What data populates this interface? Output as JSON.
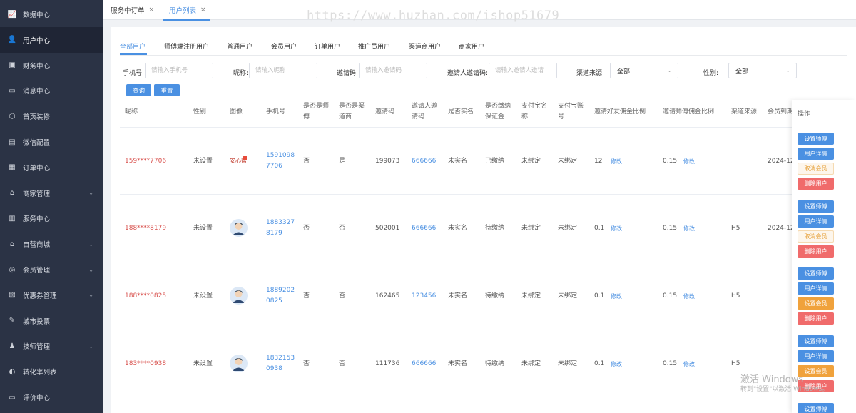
{
  "sidebar": {
    "items": [
      {
        "label": "数据中心",
        "icon": "chart-icon",
        "glyph": "📈",
        "chevron": false
      },
      {
        "label": "用户中心",
        "icon": "user-icon",
        "glyph": "👤",
        "chevron": false,
        "active": true
      },
      {
        "label": "财务中心",
        "icon": "wallet-icon",
        "glyph": "▣",
        "chevron": false
      },
      {
        "label": "消息中心",
        "icon": "message-icon",
        "glyph": "▭",
        "chevron": false
      },
      {
        "label": "首页装修",
        "icon": "box-icon",
        "glyph": "⬡",
        "chevron": false
      },
      {
        "label": "微信配置",
        "icon": "document-gear-icon",
        "glyph": "▤",
        "chevron": false
      },
      {
        "label": "订单中心",
        "icon": "order-icon",
        "glyph": "▦",
        "chevron": false
      },
      {
        "label": "商家管理",
        "icon": "home-icon",
        "glyph": "⌂",
        "chevron": true
      },
      {
        "label": "服务中心",
        "icon": "clipboard-icon",
        "glyph": "▥",
        "chevron": false
      },
      {
        "label": "自营商城",
        "icon": "shop-icon",
        "glyph": "⌂",
        "chevron": true
      },
      {
        "label": "会员管理",
        "icon": "coin-icon",
        "glyph": "◎",
        "chevron": true
      },
      {
        "label": "优惠券管理",
        "icon": "coupon-icon",
        "glyph": "▧",
        "chevron": true
      },
      {
        "label": "城市投票",
        "icon": "vote-icon",
        "glyph": "✎",
        "chevron": false
      },
      {
        "label": "技师管理",
        "icon": "technician-icon",
        "glyph": "♟",
        "chevron": true
      },
      {
        "label": "转化率列表",
        "icon": "convert-icon",
        "glyph": "◐",
        "chevron": false
      },
      {
        "label": "评价中心",
        "icon": "comment-icon",
        "glyph": "▭",
        "chevron": false
      }
    ]
  },
  "tabs": [
    {
      "label": "服务中订单",
      "close": "×"
    },
    {
      "label": "用户列表",
      "close": "×",
      "active": true
    }
  ],
  "watermark": "https://www.huzhan.com/ishop51679",
  "subtabs": [
    "全部用户",
    "师傅端注册用户",
    "普通用户",
    "会员用户",
    "订单用户",
    "推广员用户",
    "渠道商用户",
    "商家用户"
  ],
  "filters": {
    "phone_label": "手机号:",
    "phone_placeholder": "请输入手机号",
    "nick_label": "昵称:",
    "nick_placeholder": "请输入昵称",
    "code_label": "邀请码:",
    "code_placeholder": "请输入邀请码",
    "inviter_label": "邀请人邀请码:",
    "inviter_placeholder": "请输入邀请人邀请",
    "channel_label": "渠道来源:",
    "channel_value": "全部",
    "gender_label": "性别:",
    "gender_value": "全部",
    "search_label": "查询",
    "reset_label": "重置",
    "chevron": "⌄"
  },
  "table": {
    "headers": {
      "nick": "昵称",
      "gender": "性别",
      "avatar": "图像",
      "phone": "手机号",
      "is_master": [
        "是否是师",
        "傅"
      ],
      "is_channel": [
        "是否是渠",
        "道商"
      ],
      "code": "邀请码",
      "inviter": [
        "邀请人邀",
        "请码"
      ],
      "realname": "是否实名",
      "deposit": [
        "是否缴纳",
        "保证金"
      ],
      "alipay_name": [
        "支付宝名",
        "称"
      ],
      "alipay_acct": [
        "支付宝账",
        "号"
      ],
      "friend_rate": "邀请好友佣金比例",
      "master_rate": "邀请师傅佣金比例",
      "channel": "渠道来源",
      "expire": "会员到期",
      "ops": "操作"
    },
    "rows": [
      {
        "nick": "159****7706",
        "gender": "未设置",
        "avatar": "logo",
        "phone": [
          "1591098",
          "7706"
        ],
        "is_master": "否",
        "is_channel": "是",
        "code": "199073",
        "inviter": "666666",
        "realname": "未实名",
        "deposit": "已缴纳",
        "alipay_name": "未绑定",
        "alipay_acct": "未绑定",
        "friend_rate": "12",
        "master_rate": "0.15",
        "channel": "",
        "expire": "2024-12-",
        "edit": "修改",
        "member_op": "取消会员"
      },
      {
        "nick": "188****8179",
        "gender": "未设置",
        "avatar": "person",
        "phone": [
          "1883327",
          "8179"
        ],
        "is_master": "否",
        "is_channel": "否",
        "code": "502001",
        "inviter": "666666",
        "realname": "未实名",
        "deposit": "待缴纳",
        "alipay_name": "未绑定",
        "alipay_acct": "未绑定",
        "friend_rate": "0.1",
        "master_rate": "0.15",
        "channel": "H5",
        "expire": "2024-12-",
        "edit": "修改",
        "member_op": "取消会员"
      },
      {
        "nick": "188****0825",
        "gender": "未设置",
        "avatar": "person",
        "phone": [
          "1889202",
          "0825"
        ],
        "is_master": "否",
        "is_channel": "否",
        "code": "162465",
        "inviter": "123456",
        "realname": "未实名",
        "deposit": "待缴纳",
        "alipay_name": "未绑定",
        "alipay_acct": "未绑定",
        "friend_rate": "0.1",
        "master_rate": "0.15",
        "channel": "H5",
        "expire": "",
        "edit": "修改",
        "member_op": "设置会员"
      },
      {
        "nick": "183****0938",
        "gender": "未设置",
        "avatar": "person",
        "phone": [
          "1832153",
          "0938"
        ],
        "is_master": "否",
        "is_channel": "否",
        "code": "111736",
        "inviter": "666666",
        "realname": "未实名",
        "deposit": "待缴纳",
        "alipay_name": "未绑定",
        "alipay_acct": "未绑定",
        "friend_rate": "0.1",
        "master_rate": "0.15",
        "channel": "H5",
        "expire": "",
        "edit": "修改",
        "member_op": "设置会员"
      }
    ],
    "ops": {
      "set_master": "设置师傅",
      "detail": "用户详情",
      "delete": "删除用户"
    }
  },
  "windows_watermark": {
    "line1": "激活 Windows",
    "line2": "转到\"设置\"以激活 Windows。"
  },
  "colors": {
    "accent": "#4a90e2",
    "danger": "#f06b6b",
    "warning": "#f0a23c",
    "sidebar": "#2b3345"
  }
}
